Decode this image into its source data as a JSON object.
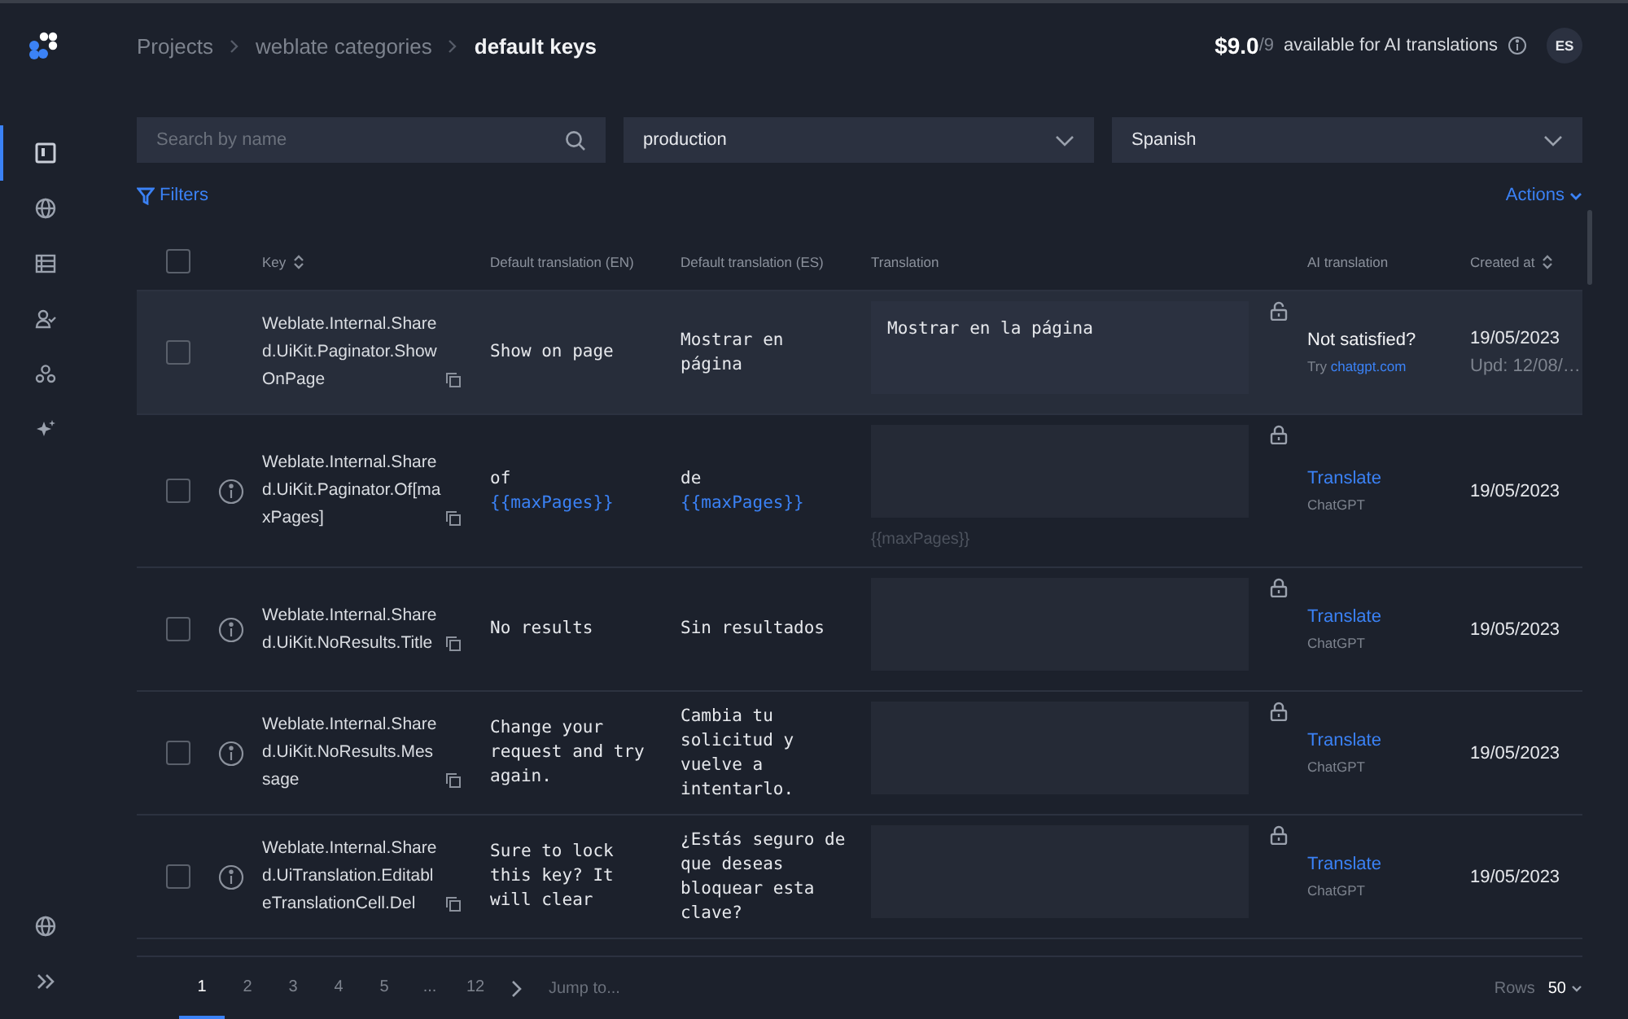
{
  "sidebar": {
    "items": [
      {
        "selected": true
      },
      {
        "selected": false
      },
      {
        "selected": false
      },
      {
        "selected": false
      },
      {
        "selected": false
      },
      {
        "selected": false
      }
    ]
  },
  "breadcrumbs": [
    {
      "label": "Projects",
      "current": false
    },
    {
      "label": "weblate categories",
      "current": false
    },
    {
      "label": "default keys",
      "current": true
    }
  ],
  "credits": {
    "amount": "$9.0",
    "total": "/9",
    "label": "available for AI translations"
  },
  "avatar": {
    "initials": "ES"
  },
  "search": {
    "placeholder": "Search by name"
  },
  "environment": {
    "value": "production"
  },
  "language": {
    "value": "Spanish"
  },
  "filters_link": "Filters",
  "actions_link": "Actions",
  "table": {
    "select_all": {
      "checked": false
    },
    "columns": [
      {
        "label": "Key",
        "sortable": true
      },
      {
        "label": "Default translation (EN)",
        "sortable": false
      },
      {
        "label": "Default translation (ES)",
        "sortable": false
      },
      {
        "label": "Translation",
        "sortable": false
      },
      {
        "label": "AI translation",
        "sortable": false
      },
      {
        "label": "Created at",
        "sortable": true
      }
    ],
    "rows": [
      {
        "selected": true,
        "checked": false,
        "info": false,
        "key": "Weblate.Internal.Shared.UiKit.Paginator.ShowOnPage",
        "en": "Show on page",
        "es": "Mostrar en página",
        "translation": "Mostrar en la página",
        "locked": false,
        "ai": {
          "kind": "feedback",
          "title": "Not satisfied?",
          "prefix": "Try",
          "link": "chatgpt.com"
        },
        "created": "19/05/2023",
        "updated": "Upd: 12/08/…"
      },
      {
        "selected": false,
        "checked": false,
        "info": true,
        "key": "Weblate.Internal.Shared.UiKit.Paginator.Of[maxPages]",
        "en": "of",
        "en_variable": "{{maxPages}}",
        "es": "de",
        "es_variable": "{{maxPages}}",
        "hint": "{{maxPages}}",
        "locked": true,
        "ai": {
          "kind": "translate",
          "title": "Translate",
          "provider": "ChatGPT"
        },
        "created": "19/05/2023"
      },
      {
        "selected": false,
        "checked": false,
        "info": true,
        "key": "Weblate.Internal.Shared.UiKit.NoResults.Title",
        "en": "No results",
        "es": "Sin resultados",
        "locked": true,
        "ai": {
          "kind": "translate",
          "title": "Translate",
          "provider": "ChatGPT"
        },
        "created": "19/05/2023"
      },
      {
        "selected": false,
        "checked": false,
        "info": true,
        "key": "Weblate.Internal.Shared.UiKit.NoResults.Message",
        "en": "Change your request and try again.",
        "es": "Cambia tu solicitud y vuelve a intentarlo.",
        "locked": true,
        "ai": {
          "kind": "translate",
          "title": "Translate",
          "provider": "ChatGPT"
        },
        "created": "19/05/2023"
      },
      {
        "selected": false,
        "checked": false,
        "info": true,
        "key": "Weblate.Internal.Shared.UiTranslation.EditableTranslationCell.Del",
        "en": "Sure to lock this key? It will clear",
        "es": "¿Estás seguro de que deseas bloquear esta clave?",
        "locked": true,
        "ai": {
          "kind": "translate",
          "title": "Translate",
          "provider": "ChatGPT"
        },
        "created": "19/05/2023"
      }
    ]
  },
  "pagination": {
    "pages": [
      {
        "label": "1",
        "selected": true
      },
      {
        "label": "2",
        "selected": false
      },
      {
        "label": "3",
        "selected": false
      },
      {
        "label": "4",
        "selected": false
      },
      {
        "label": "5",
        "selected": false
      },
      {
        "label": "...",
        "selected": false
      },
      {
        "label": "12",
        "selected": false
      }
    ],
    "jump_placeholder": "Jump to...",
    "rows_label": "Rows",
    "rows_value": "50"
  }
}
